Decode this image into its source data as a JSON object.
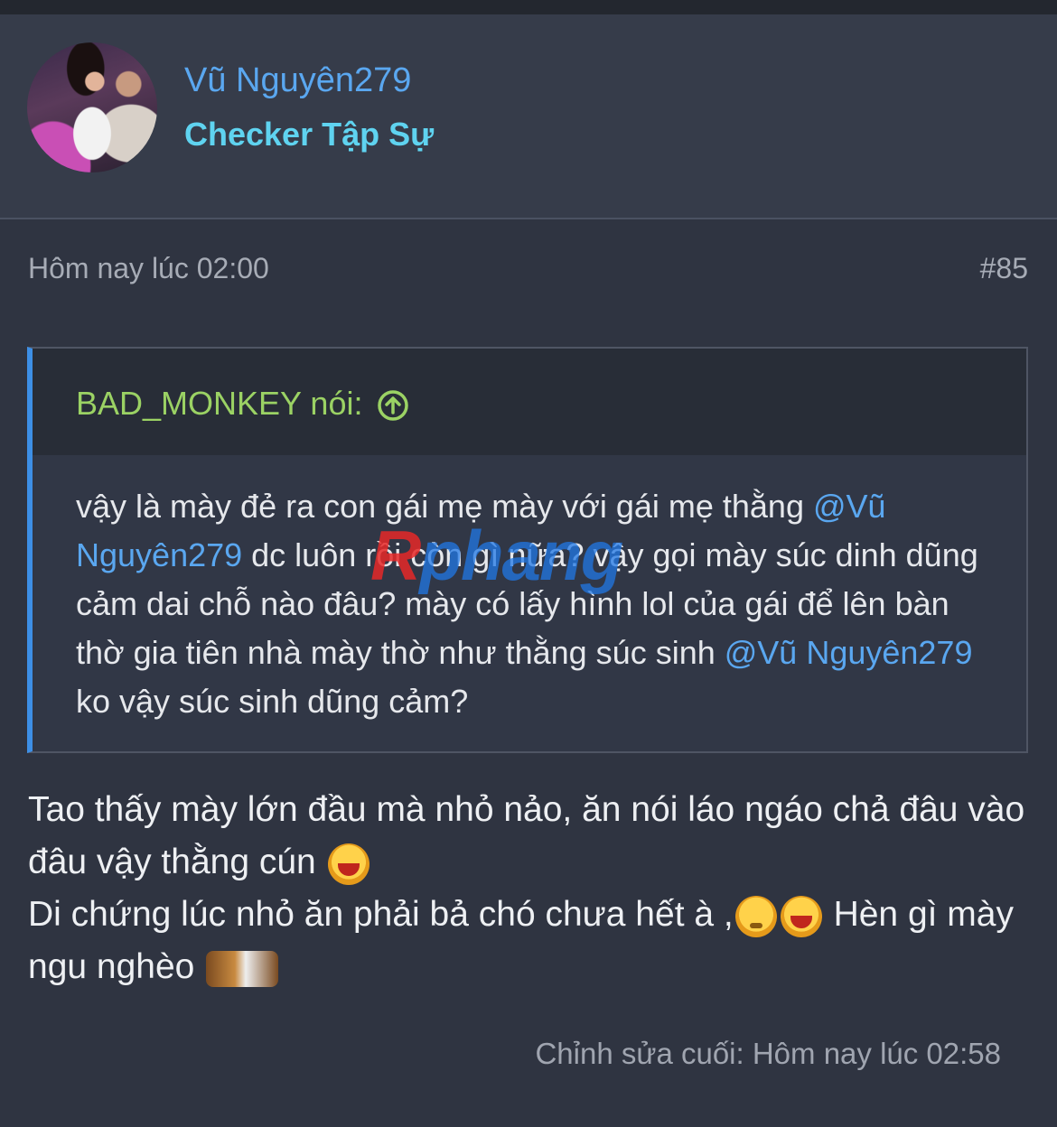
{
  "header": {
    "username": "Vũ Nguyên279",
    "user_title": "Checker Tập Sự"
  },
  "post": {
    "time": "Hôm nay lúc 02:00",
    "number": "#85",
    "quote": {
      "author": "BAD_MONKEY nói:",
      "text_1": "vậy là mày đẻ ra con gái mẹ mày với gái mẹ thằng ",
      "mention_1": "@Vũ Nguyên279",
      "text_2": " dc luôn rồi còn gì nữa? vậy gọi mày súc dinh dũng cảm dai chỗ nào đâu? mày có lấy hình lol của gái để lên bàn thờ gia tiên nhà mày thờ như thằng súc sinh ",
      "mention_2": "@Vũ Nguyên279",
      "text_3": " ko vậy súc sinh dũng cảm?"
    },
    "message": {
      "line_1": "Tao thấy mày lớn đầu mà nhỏ nảo, ăn nói láo ngáo chả đâu vào đâu vậy thằng cún ",
      "line_2a": "Di chứng lúc nhỏ ăn phải bả chó chưa hết à ,",
      "line_2b": " Hèn gì mày ngu nghèo "
    },
    "edited": "Chỉnh sửa cuối: Hôm nay lúc 02:58"
  },
  "watermark": {
    "part_1": "R",
    "part_2": "phang"
  },
  "colors": {
    "background": "#2f3441",
    "link": "#5aa7f0",
    "quote_author": "#9bd264",
    "quote_bar": "#3d8fe6"
  },
  "icons": [
    "smile-laugh-emoji",
    "thinking-emoji",
    "rage-emoji",
    "arrow-up-circle-icon"
  ]
}
